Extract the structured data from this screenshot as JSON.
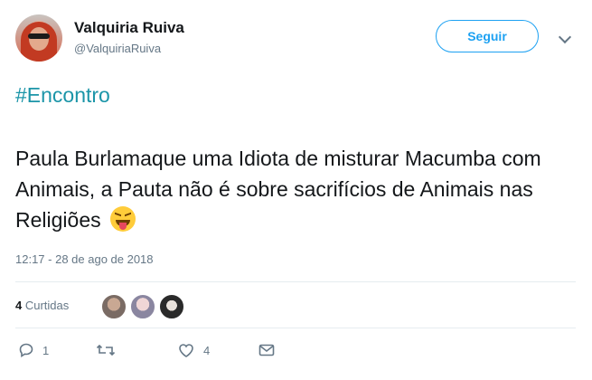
{
  "user": {
    "display_name": "Valquiria Ruiva",
    "handle": "@ValquiriaRuiva"
  },
  "follow_label": "Seguir",
  "tweet": {
    "hashtag": "#Encontro",
    "text": "Paula Burlamaque uma Idiota de misturar Macumba com Animais, a Pauta não é sobre sacrifícios de Animais nas Religiões",
    "emoji_icon": "squinting-face-with-tongue-icon",
    "timestamp": "12:17 - 28 de ago de 2018"
  },
  "likes": {
    "count": "4",
    "label": "Curtidas"
  },
  "actions": {
    "reply_count": "1",
    "like_count": "4"
  },
  "colors": {
    "accent": "#1da1f2",
    "hashtag": "#1b95a8",
    "muted": "#657786",
    "divider": "#e6ecf0"
  }
}
